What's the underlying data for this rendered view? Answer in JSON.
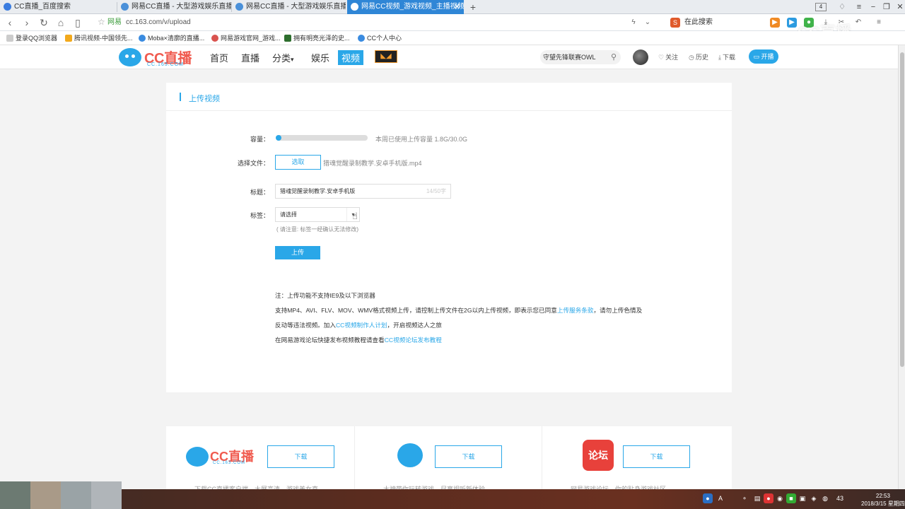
{
  "browser": {
    "tabs": [
      {
        "title": "CC直播_百度搜索",
        "active": false
      },
      {
        "title": "网易CC直播 - 大型游戏娱乐直播平台",
        "active": false
      },
      {
        "title": "网易CC直播 - 大型游戏娱乐直播平台",
        "active": false
      },
      {
        "title": "网易CC视频_游戏视频_主播视频_美:",
        "active": true
      }
    ],
    "tab_count": "4",
    "address": {
      "secure_label": "网易",
      "url": "cc.163.com/v/upload"
    },
    "search_label": "在此搜索",
    "bookmarks": [
      "登录QQ浏览器",
      "腾讯视频-中国领先...",
      "Moba×清廓的直播...",
      "网易游戏官网_游戏...",
      "拥有明亮光泽的史...",
      "CC个人中心"
    ],
    "watermark": "CC直播"
  },
  "site": {
    "logo": {
      "brand": "CC直播",
      "sub": "CC.163.COM"
    },
    "nav": [
      "首页",
      "直播",
      "分类",
      "娱乐",
      "视频"
    ],
    "search_value": "守望先锋联赛OWL",
    "links": {
      "follow": "关注",
      "history": "历史",
      "download": "下载",
      "live": "开播"
    }
  },
  "upload": {
    "header": "上传视频",
    "capacity_label": "容量：",
    "capacity_progress": 0.06,
    "capacity_text": "本周已使用上传容量 1.8G/30.0G",
    "file_label": "选择文件：",
    "pick_button": "选取",
    "file_name": "猎魂觉醒录制教学.安卓手机版.mp4",
    "title_label": "标题：",
    "title_value": "猎魂觉醒录制教学.安卓手机版",
    "title_counter": "14/50字",
    "tag_label": "标签：",
    "tag_placeholder": "请选择",
    "tag_note": "( 请注意: 标签一经确认无法修改)",
    "submit_button": "上传"
  },
  "notes": {
    "line1": "注：上传功能不支持IE9及以下浏览器",
    "line2_a": "支持MP4、AVI、FLV、MOV、WMV格式视频上传，请控制上传文件在2G以内上传视频，即表示您已同意",
    "line2_link": "上传服务条款",
    "line2_b": "，请勿上传色情及",
    "line3_a": "反动等违法视频。加入",
    "line3_link": "CC视频制作人计划",
    "line3_b": "，开启视频达人之旅",
    "line4_a": "在网易游戏论坛快捷发布视频教程请查看",
    "line4_link": "CC视频论坛发布教程"
  },
  "downloads": {
    "buttons": [
      "下载",
      "下载",
      "下载"
    ],
    "forum_icon_text": "论坛",
    "captions": [
      "下载CC直播客户端，大屏高清，游戏美女直",
      "大神带你玩转游戏，尽享视听新体验",
      "网易游戏论坛，你的贴身游戏社区"
    ]
  },
  "taskbar": {
    "time": "22:53",
    "date": "2018/3/15 星期四",
    "ime": "A",
    "volume": "43"
  }
}
